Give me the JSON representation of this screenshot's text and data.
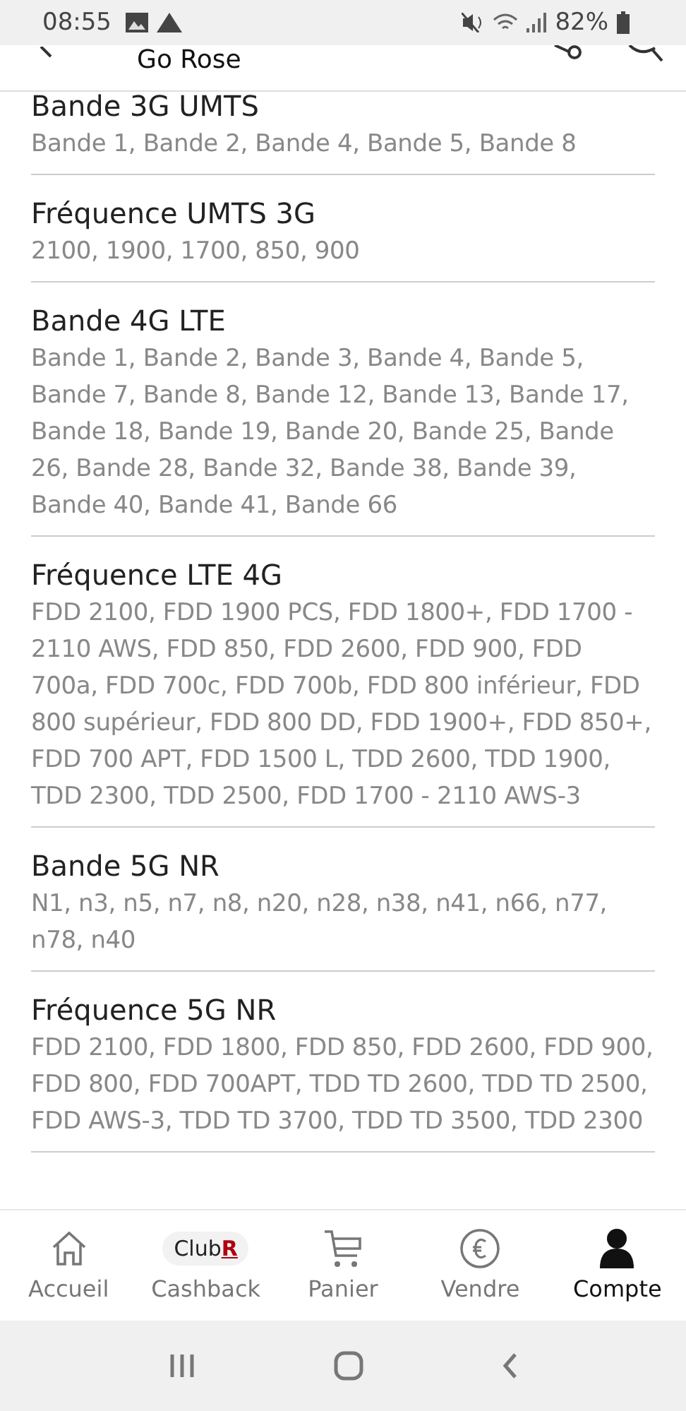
{
  "status_bar": {
    "time": "08:55",
    "battery": "82%"
  },
  "header": {
    "title": "Go Rose"
  },
  "specs": [
    {
      "title": "Bande 3G UMTS",
      "value": "Bande 1, Bande 2, Bande 4, Bande 5, Bande 8"
    },
    {
      "title": "Fréquence UMTS 3G",
      "value": "2100, 1900, 1700, 850, 900"
    },
    {
      "title": "Bande 4G LTE",
      "value": "Bande 1, Bande 2, Bande 3, Bande 4, Bande 5, Bande 7, Bande 8, Bande 12, Bande 13, Bande 17, Bande 18, Bande 19, Bande 20, Bande 25, Bande 26, Bande 28, Bande 32, Bande 38, Bande 39, Bande 40, Bande 41, Bande 66"
    },
    {
      "title": "Fréquence LTE 4G",
      "value": "FDD 2100, FDD 1900 PCS, FDD 1800+, FDD 1700 - 2110 AWS, FDD 850, FDD 2600, FDD 900, FDD 700a, FDD 700c, FDD 700b, FDD 800 inférieur, FDD 800 supérieur, FDD 800 DD, FDD 1900+, FDD 850+, FDD 700 APT, FDD 1500 L, TDD 2600, TDD 1900, TDD 2300, TDD 2500, FDD 1700 - 2110 AWS-3"
    },
    {
      "title": "Bande 5G NR",
      "value": "N1, n3, n5, n7, n8, n20, n28, n38, n41, n66, n77, n78, n40"
    },
    {
      "title": "Fréquence 5G NR",
      "value": "FDD 2100, FDD 1800, FDD 850, FDD 2600, FDD 900, FDD 800, FDD 700APT, TDD TD 2600, TDD TD 2500, FDD AWS-3, TDD TD 3700, TDD TD 3500, TDD 2300"
    }
  ],
  "bottom_nav": [
    {
      "kind": "home",
      "label": "Accueil",
      "selected": false
    },
    {
      "kind": "club",
      "badge": "Club",
      "badge_mark": "R",
      "label": "Cashback",
      "selected": false
    },
    {
      "kind": "cart",
      "label": "Panier",
      "selected": false
    },
    {
      "kind": "euro",
      "label": "Vendre",
      "selected": false
    },
    {
      "kind": "account",
      "label": "Compte",
      "selected": true
    }
  ]
}
